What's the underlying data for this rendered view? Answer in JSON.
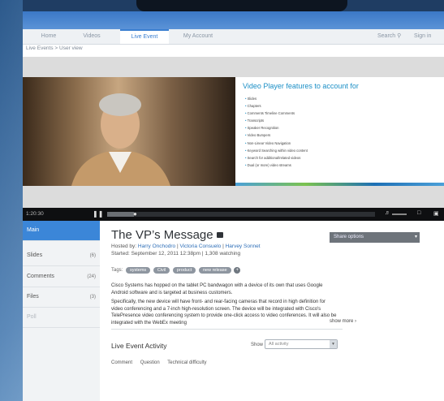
{
  "nav": {
    "items": [
      "Home",
      "Videos",
      "Live Event",
      "My Account"
    ],
    "search_label": "Search",
    "signin_label": "Sign in"
  },
  "breadcrumb": {
    "root": "Live Events",
    "separator": ">",
    "current": "User view"
  },
  "slide": {
    "title": "Video Player features to account for",
    "bullets": [
      "Slides",
      "Chapters",
      "Comments Timeline Comments",
      "Transcripts",
      "Speaker Recognition",
      "Video Bumpers",
      "Non-Linear Video Navigation",
      "Keyword Searching within video content",
      "Search for additional/related videos",
      "Dual (or more) video streams"
    ]
  },
  "player": {
    "time": "1:20:30",
    "progress": 0.1
  },
  "sidebar": {
    "items": [
      {
        "label": "Main",
        "count": ""
      },
      {
        "label": "Slides",
        "count": "(6)"
      },
      {
        "label": "Comments",
        "count": "(24)"
      },
      {
        "label": "Files",
        "count": "(3)"
      },
      {
        "label": "Poll",
        "count": ""
      }
    ]
  },
  "event": {
    "title": "The VP’s Message",
    "hosted_prefix": "Hosted by:",
    "hosts": [
      "Harry Onchodro",
      "Victoria Consuelo",
      "Harvey Sonnet"
    ],
    "started": "Started: September 12, 2011 12:38pm | 1,308 watching",
    "tags_label": "Tags:",
    "tags": [
      "systems",
      "Civil",
      "product",
      "new release"
    ],
    "para1": "Cisco Systems has hopped on the tablet PC bandwagon with a device of its own that uses Google Android software and is targeted at business customers.",
    "para2": "Specifically, the new device will have front- and rear-facing cameras that record in high definition for video conferencing and a 7-inch high-resolution screen. The device will be integrated with Cisco's TelePresence video conferencing system to provide one-click access to video conferences. It will also be integrated with the WebEx meeting",
    "show_more": "show more ›"
  },
  "activity": {
    "title": "Live Event Activity",
    "show_label": "Show",
    "filter_value": "All activity",
    "tabs": [
      "Comment",
      "Question",
      "Technical difficulty"
    ]
  },
  "share": {
    "label": "Share options"
  },
  "colors": {
    "accent": "#3b86d8",
    "link": "#2f6fb8",
    "slide_title": "#1b8fc6"
  }
}
